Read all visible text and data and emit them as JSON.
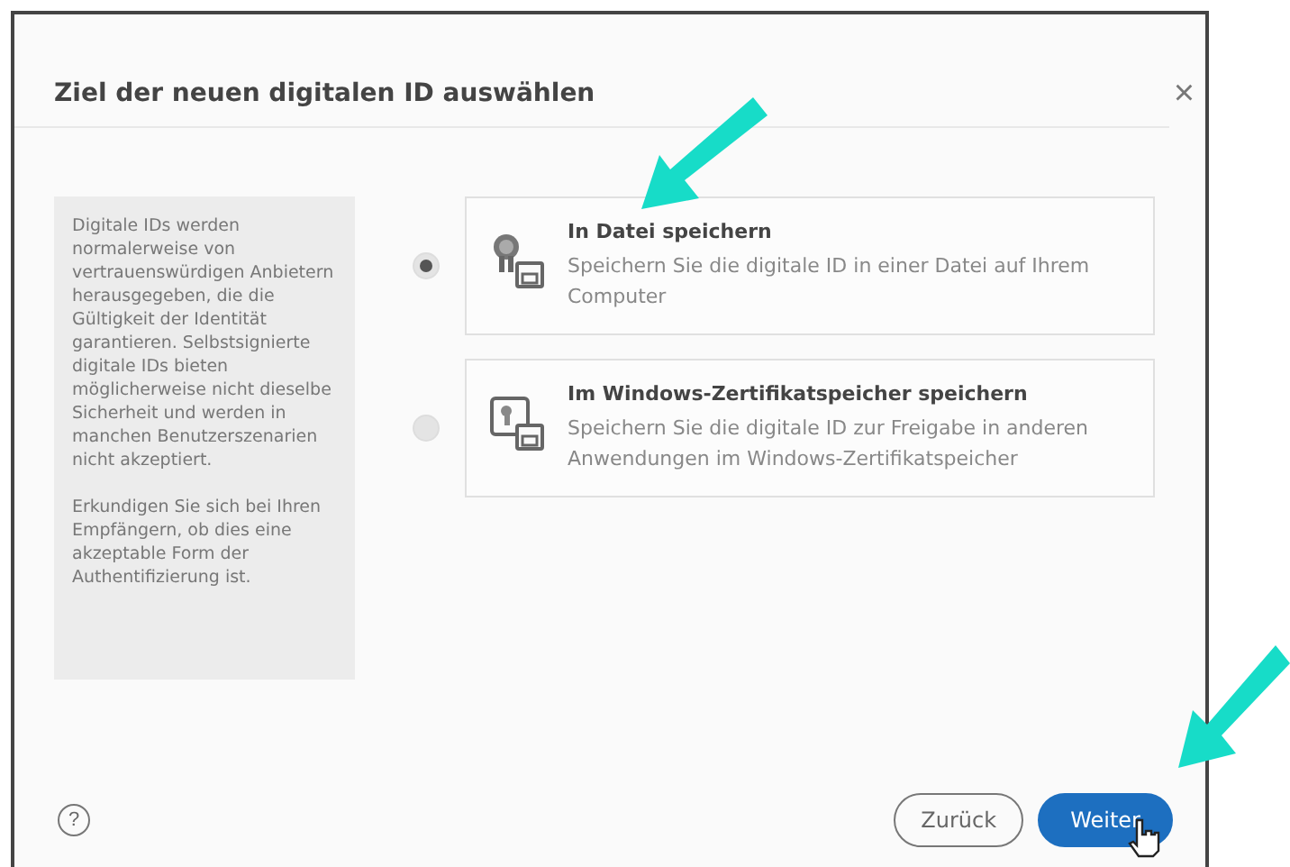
{
  "dialog": {
    "title": "Ziel der neuen digitalen ID auswählen",
    "close": "×"
  },
  "info": [
    "Digitale IDs werden normalerweise von vertrauenswürdigen Anbietern herausgegeben, die die Gültigkeit der Identität garantieren. Selbstsignierte digitale IDs bieten möglicherweise nicht dieselbe Sicherheit und werden in manchen Benutzerszenarien nicht akzeptiert.",
    "Erkundigen Sie sich bei Ihren Empfängern, ob dies eine akzeptable Form der Authentifizierung ist."
  ],
  "options": [
    {
      "title": "In Datei speichern",
      "description": "Speichern Sie die digitale ID in einer Datei auf Ihrem Computer",
      "selected": true,
      "kind": "file"
    },
    {
      "title": "Im Windows-Zertifikatspeicher speichern",
      "description": "Speichern Sie die digitale ID zur Freigabe in anderen Anwendungen im Windows-Zertifikatspeicher",
      "selected": false,
      "kind": "store"
    }
  ],
  "help": "?",
  "buttons": [
    {
      "label": "Zurück",
      "kind": "secondary"
    },
    {
      "label": "Weiter",
      "kind": "primary"
    }
  ]
}
